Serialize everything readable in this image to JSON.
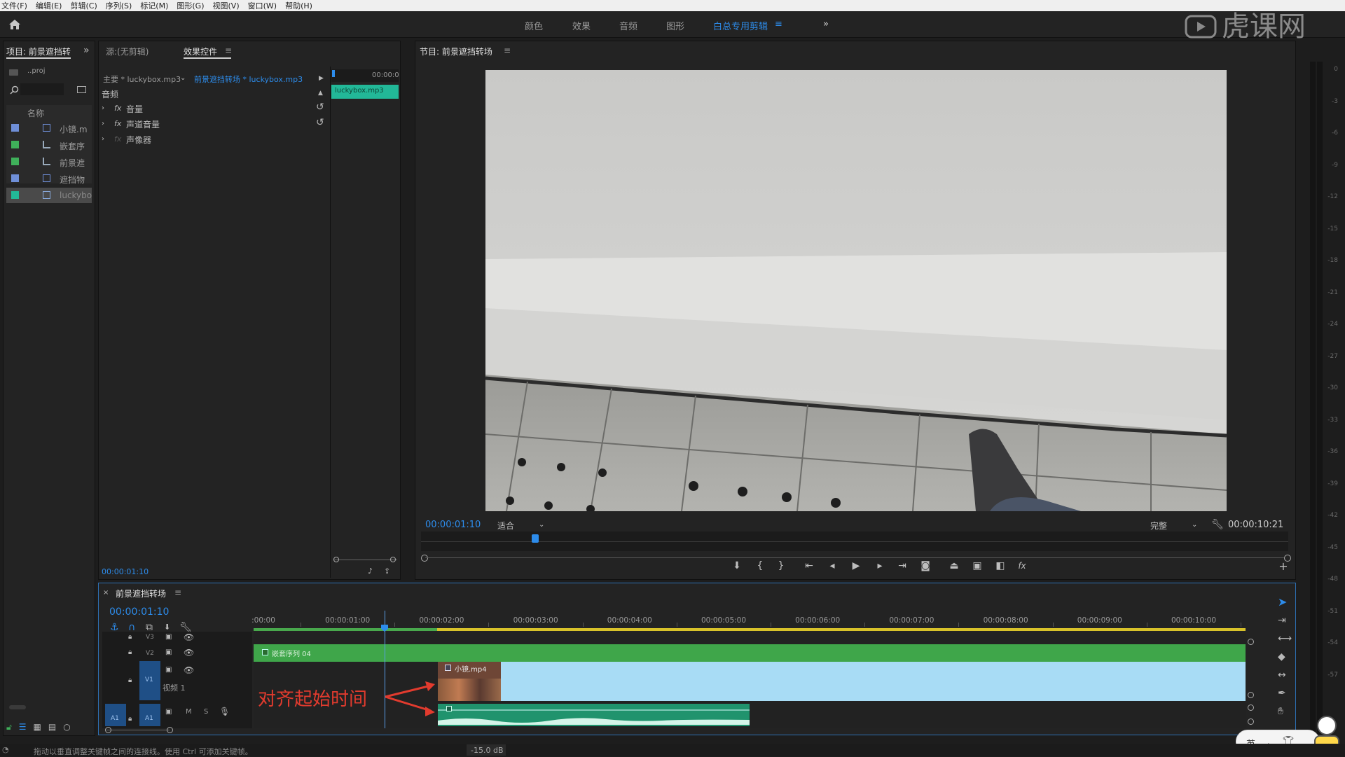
{
  "menu": [
    "文件(F)",
    "编辑(E)",
    "剪辑(C)",
    "序列(S)",
    "标记(M)",
    "图形(G)",
    "视图(V)",
    "窗口(W)",
    "帮助(H)"
  ],
  "workspaces": [
    "颜色",
    "效果",
    "音频",
    "图形"
  ],
  "workspace_active": "白总专用剪辑",
  "watermark": "虎课网",
  "project": {
    "title": "项目: 前景遮挡转",
    "file": "..proj",
    "column_name": "名称",
    "items": [
      {
        "name": "小镜.m",
        "color": "#6f8fd8"
      },
      {
        "name": "嵌套序",
        "color": "#3fb05a"
      },
      {
        "name": "前景遮",
        "color": "#3fb05a"
      },
      {
        "name": "遮挡物",
        "color": "#6f8fd8"
      },
      {
        "name": "luckybo",
        "color": "#22b898"
      }
    ]
  },
  "source": {
    "tab_source": "源:(无剪辑)",
    "tab_effects": "效果控件",
    "master": "主要 * luckybox.mp3",
    "sequence_clip": "前景遮挡转场 * luckybox.mp3",
    "timecode_top": "00:00:0",
    "clip_label": "luckybox.mp3",
    "section": "音频",
    "effects": [
      "音量",
      "声道音量",
      "声像器"
    ],
    "timecode_bottom": "00:00:01:10"
  },
  "program": {
    "title": "节目: 前景遮挡转场",
    "timecode": "00:00:01:10",
    "fit": "适合",
    "quality": "完整",
    "duration": "00:00:10:21"
  },
  "timeline": {
    "title": "前景遮挡转场",
    "timecode": "00:00:01:10",
    "ruler": [
      ":00:00",
      "00:00:01:00",
      "00:00:02:00",
      "00:00:03:00",
      "00:00:04:00",
      "00:00:05:00",
      "00:00:06:00",
      "00:00:07:00",
      "00:00:08:00",
      "00:00:09:00",
      "00:00:10:00"
    ],
    "tracks": {
      "v3": "V3",
      "v2": "V2",
      "v1": "V1",
      "v1_name": "视频 1",
      "a1": "A1",
      "m": "M",
      "s": "S"
    },
    "clip_nested": "嵌套序列 04",
    "clip_video": "小镜.mp4"
  },
  "annotation": "对齐起始时间",
  "status": {
    "hint": "拖动以垂直调整关键帧之间的连接线。使用 Ctrl 可添加关键帧。",
    "db": "-15.0 dB"
  },
  "meter_db": [
    "0",
    "-3",
    "-6",
    "-9",
    "-12",
    "-15",
    "-18",
    "-21",
    "-24",
    "-27",
    "-30",
    "-33",
    "-36",
    "-39",
    "-42",
    "-45",
    "-48",
    "-51",
    "-54",
    "-57"
  ],
  "ime": {
    "lang": "英"
  }
}
